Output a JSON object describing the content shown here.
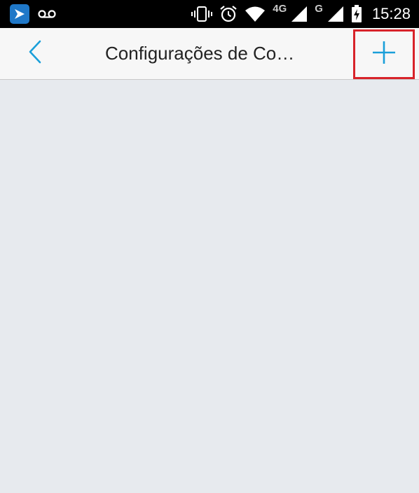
{
  "status_bar": {
    "time": "15:28",
    "network_1": "4G",
    "network_2": "G",
    "icons": [
      "app-notification-icon",
      "voicemail-icon",
      "vibrate-icon",
      "alarm-icon",
      "wifi-icon",
      "signal-4g-icon",
      "signal-g-icon",
      "battery-charging-icon"
    ]
  },
  "nav": {
    "title": "Configurações de Co…",
    "back_icon": "chevron-left-icon",
    "add_icon": "plus-icon"
  },
  "colors": {
    "accent": "#1a9fd9",
    "highlight_border": "#d8232a",
    "background": "#e7eaee",
    "nav_background": "#f7f7f7"
  }
}
